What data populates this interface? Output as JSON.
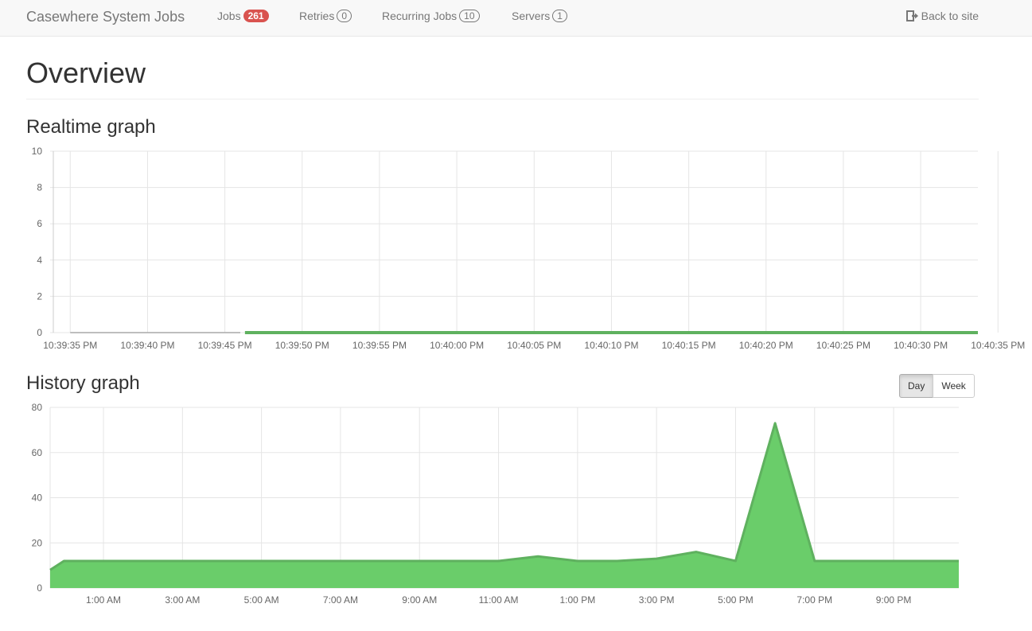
{
  "navbar": {
    "brand": "Casewhere System Jobs",
    "items": [
      {
        "label": "Jobs",
        "badge": "261",
        "badge_style": "red"
      },
      {
        "label": "Retries",
        "badge": "0",
        "badge_style": "outline"
      },
      {
        "label": "Recurring Jobs",
        "badge": "10",
        "badge_style": "outline"
      },
      {
        "label": "Servers",
        "badge": "1",
        "badge_style": "outline"
      }
    ],
    "back_label": "Back to site",
    "back_icon": "sign-out-icon"
  },
  "page": {
    "title": "Overview",
    "realtime_title": "Realtime graph",
    "history_title": "History graph",
    "history_toggle": {
      "day_label": "Day",
      "week_label": "Week",
      "selected": "Day"
    }
  },
  "colors": {
    "accent_green": "#6acd6a",
    "line_green": "#5fb15f",
    "line_gray": "#a9a9a9",
    "badge_red": "#d9534f"
  },
  "chart_data": [
    {
      "name": "realtime",
      "type": "line",
      "ylim": [
        0,
        10
      ],
      "yticks": [
        0,
        2,
        4,
        6,
        8,
        10
      ],
      "xtick_labels": [
        "10:39:35 PM",
        "10:39:40 PM",
        "10:39:45 PM",
        "10:39:50 PM",
        "10:39:55 PM",
        "10:40:00 PM",
        "10:40:05 PM",
        "10:40:10 PM",
        "10:40:15 PM",
        "10:40:20 PM",
        "10:40:25 PM",
        "10:40:30 PM",
        "10:40:35 PM"
      ],
      "x_range_seconds": [
        -1.3,
        58.7
      ],
      "series": [
        {
          "values_x": [
            0,
            11
          ],
          "values_y": [
            0,
            0
          ],
          "color": "#a9a9a9"
        },
        {
          "values_x": [
            11.3,
            58.7
          ],
          "values_y": [
            0,
            0
          ],
          "color": "#5fb15f"
        }
      ]
    },
    {
      "name": "history",
      "type": "area",
      "ylim": [
        0,
        80
      ],
      "yticks": [
        0,
        20,
        40,
        60,
        80
      ],
      "xtick_labels": [
        "1:00 AM",
        "3:00 AM",
        "5:00 AM",
        "7:00 AM",
        "9:00 AM",
        "11:00 AM",
        "1:00 PM",
        "3:00 PM",
        "5:00 PM",
        "7:00 PM",
        "9:00 PM"
      ],
      "x_range_hours": [
        -0.35,
        22.65
      ],
      "series": [
        {
          "values_x": [
            -0.35,
            0.0,
            1.0,
            2.0,
            3.0,
            4.0,
            5.0,
            6.0,
            7.0,
            8.0,
            9.0,
            10.0,
            11.0,
            12.0,
            13.0,
            14.0,
            15.0,
            16.0,
            17.0,
            18.0,
            19.0,
            20.0,
            21.0,
            22.0,
            22.65
          ],
          "values_y": [
            8,
            12,
            12,
            12,
            12,
            12,
            12,
            12,
            12,
            12,
            12,
            12,
            12,
            14,
            12,
            12,
            13,
            16,
            12,
            73,
            12,
            12,
            12,
            12,
            12
          ],
          "fill": "#6acd6a",
          "color": "#5fb15f"
        }
      ]
    }
  ]
}
